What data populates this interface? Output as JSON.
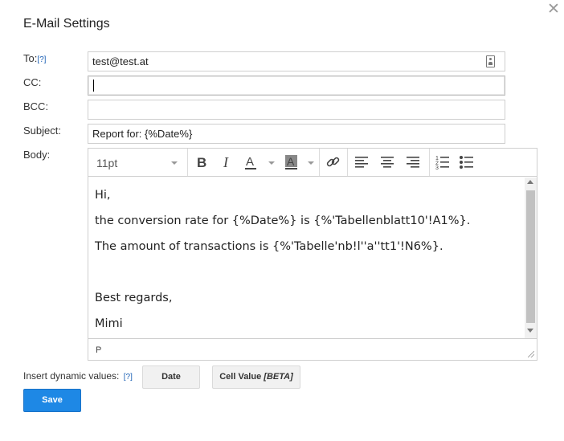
{
  "dialog": {
    "title": "E-Mail Settings",
    "close_glyph": "✕"
  },
  "form": {
    "to_label": "To:",
    "help_marker": "[?]",
    "to_value": "test@test.at",
    "cc_label": "CC:",
    "cc_value": "",
    "bcc_label": "BCC:",
    "bcc_value": "",
    "subject_label": "Subject:",
    "subject_value": "Report for: {%Date%}",
    "body_label": "Body:"
  },
  "editor": {
    "font_size": "11pt",
    "toolbar_icons": [
      "bold-icon",
      "italic-icon",
      "text-color-icon",
      "background-color-icon",
      "link-icon",
      "align-left-icon",
      "align-center-icon",
      "align-right-icon",
      "numbered-list-icon",
      "bulleted-list-icon"
    ],
    "lines": [
      "Hi,",
      "the conversion rate for {%Date%} is {%'Tabellenblatt10'!A1%}.",
      "The amount of transactions is {%'Tabelle'nb!l''a''tt1'!N6%}.",
      "Best regards,",
      "Mimi"
    ],
    "path": "P"
  },
  "dynamic": {
    "label": "Insert dynamic values:",
    "help_marker": "[?]",
    "date_button": "Date",
    "cell_value_button": "Cell Value",
    "cell_value_suffix": "[BETA]"
  },
  "actions": {
    "save_label": "Save"
  },
  "colors": {
    "accent": "#1e88e5",
    "link": "#1a5fb4"
  }
}
